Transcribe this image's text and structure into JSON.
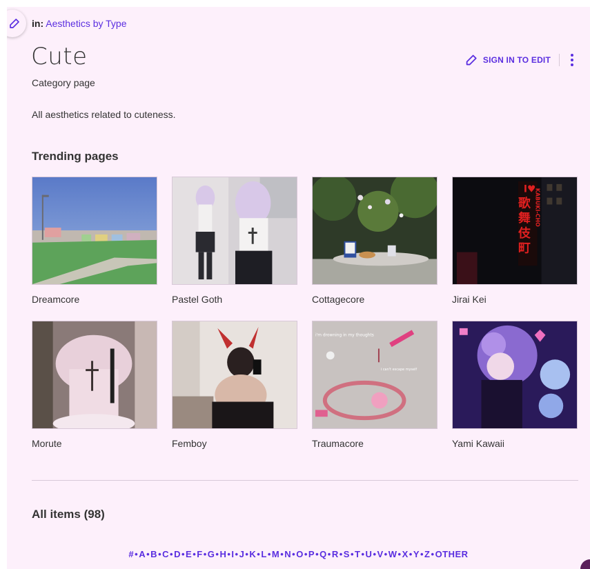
{
  "breadcrumb": {
    "prefix": "in:",
    "link": "Aesthetics by Type"
  },
  "page": {
    "title": "Cute",
    "subtitle": "Category page",
    "description": "All aesthetics related to cuteness."
  },
  "actions": {
    "sign_in_label": "SIGN IN TO EDIT"
  },
  "trending": {
    "heading": "Trending pages",
    "items": [
      {
        "label": "Dreamcore"
      },
      {
        "label": "Pastel Goth"
      },
      {
        "label": "Cottagecore"
      },
      {
        "label": "Jirai Kei"
      },
      {
        "label": "Morute"
      },
      {
        "label": "Femboy"
      },
      {
        "label": "Traumacore"
      },
      {
        "label": "Yami Kawaii"
      }
    ]
  },
  "thumb_text": {
    "jirai_sign_heart": "I♥",
    "jirai_sign_kanji": [
      "歌",
      "舞",
      "伎",
      "町"
    ],
    "jirai_sign_latin": "KABUKI-CHO",
    "trauma_caption_1": "i'm drowning in my thoughts",
    "trauma_caption_2": "i can't escape myself"
  },
  "all_items": {
    "heading": "All items (98)"
  },
  "alpha_nav": [
    "#",
    "A",
    "B",
    "C",
    "D",
    "E",
    "F",
    "G",
    "H",
    "I",
    "J",
    "K",
    "L",
    "M",
    "N",
    "O",
    "P",
    "Q",
    "R",
    "S",
    "T",
    "U",
    "V",
    "W",
    "X",
    "Y",
    "Z",
    "OTHER"
  ],
  "colors": {
    "accent": "#5a2ee0",
    "background": "#fdf0fb",
    "text": "#333333"
  }
}
